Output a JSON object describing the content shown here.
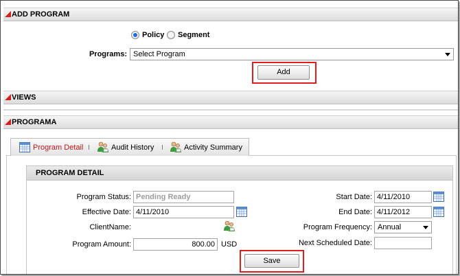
{
  "add_program": {
    "title": "ADD PROGRAM",
    "radio_policy": "Policy",
    "radio_segment": "Segment",
    "programs_label": "Programs:",
    "programs_value": "Select Program",
    "add_label": "Add"
  },
  "views": {
    "title": "VIEWS"
  },
  "programa": {
    "title": "PROGRAMA",
    "tabs": [
      {
        "label": "Program Detail",
        "icon": "calendar-icon"
      },
      {
        "label": "Audit History",
        "icon": "people-icon"
      },
      {
        "label": "Activity Summary",
        "icon": "people-icon"
      }
    ],
    "detail_title": "PROGRAM DETAIL",
    "fields": {
      "status_label": "Program Status:",
      "status_value": "Pending Ready",
      "effective_label": "Effective Date:",
      "effective_value": "4/11/2010",
      "client_label": "ClientName:",
      "amount_label": "Program Amount:",
      "amount_value": "800.00",
      "amount_currency": "USD",
      "start_label": "Start Date:",
      "start_value": "4/11/2010",
      "end_label": "End Date:",
      "end_value": "4/11/2012",
      "frequency_label": "Program Frequency:",
      "frequency_value": "Annual",
      "next_label": "Next Scheduled Date:",
      "next_value": ""
    },
    "save_label": "Save"
  },
  "colors": {
    "accent_red": "#e01c1c",
    "triangle_red": "#d21f1f",
    "radio_blue": "#1e6fd9"
  }
}
